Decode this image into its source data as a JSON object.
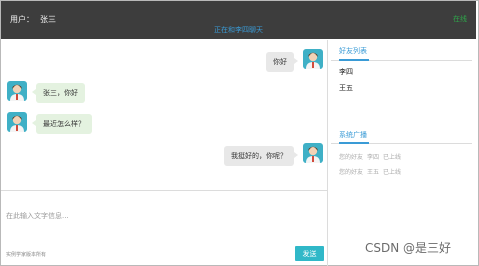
{
  "header": {
    "user_label": "用户：",
    "user_name": "张三",
    "status": "在线",
    "chat_title": "正在和李四聊天",
    "status_color": "#2ea64a"
  },
  "messages": [
    {
      "from": "self",
      "text": "你好"
    },
    {
      "from": "other",
      "text": "张三，你好"
    },
    {
      "from": "other",
      "text": "最近怎么样？"
    },
    {
      "from": "self",
      "text": "我挺好的，你呢？"
    }
  ],
  "composer": {
    "placeholder": "在此输入文字信息...",
    "copyright": "实例学家版本所有",
    "send_label": "发送"
  },
  "sidebar": {
    "friends_heading": "好友列表",
    "friends": [
      "李四",
      "王五"
    ],
    "notices_heading": "系统广播",
    "notices": [
      {
        "prefix": "您的好友",
        "name": "李四",
        "action": "已上线"
      },
      {
        "prefix": "您的好友",
        "name": "王五",
        "action": "已上线"
      }
    ]
  },
  "watermark": "CSDN @是三好",
  "colors": {
    "accent": "#3a9bd6",
    "send_button": "#30b8c8",
    "header_bg": "#3d3d3d"
  }
}
